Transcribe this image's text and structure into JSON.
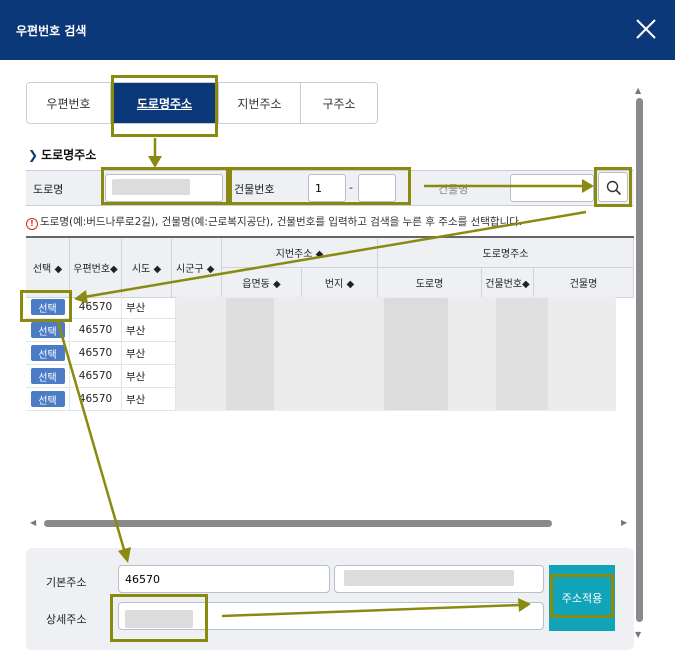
{
  "dialog": {
    "title": "우편번호 검색"
  },
  "tabs": [
    {
      "label": "우편번호",
      "active": false
    },
    {
      "label": "도로명주소",
      "active": true
    },
    {
      "label": "지번주소",
      "active": false
    },
    {
      "label": "구주소",
      "active": false
    }
  ],
  "section": {
    "title": "도로명주소"
  },
  "search": {
    "road_label": "도로명",
    "building_no_label": "건물번호",
    "building_no_main": "1",
    "building_no_dash": "-",
    "building_no_sub": "",
    "building_name_label": "건물명"
  },
  "notice": "도로명(예:버드나루로2길), 건물명(예:근로복지공단), 건물번호를 입력하고 검색을 누른 후 주소를 선택합니다.",
  "grid": {
    "headers": {
      "select": "선택 ◆",
      "zip": "우편번호◆",
      "sido": "시도 ◆",
      "sigungu": "시군구 ◆",
      "jibun_group": "지번주소 ◆",
      "umd": "읍면동 ◆",
      "bunji": "번지 ◆",
      "road_group": "도로명주소",
      "road_name": "도로명",
      "bldg_no": "건물번호◆",
      "bldg_name": "건물명"
    },
    "rows": [
      {
        "select": "선택",
        "zip": "46570",
        "sido": "부산"
      },
      {
        "select": "선택",
        "zip": "46570",
        "sido": "부산"
      },
      {
        "select": "선택",
        "zip": "46570",
        "sido": "부산"
      },
      {
        "select": "선택",
        "zip": "46570",
        "sido": "부산"
      },
      {
        "select": "선택",
        "zip": "46570",
        "sido": "부산"
      }
    ]
  },
  "bottom": {
    "base_label": "기본주소",
    "base_zip": "46570",
    "detail_label": "상세주소",
    "apply_label": "주소적용"
  },
  "colors": {
    "header": "#0b3878",
    "apply": "#11a3b7",
    "select_button": "#4c7cc6",
    "highlight": "#8a8a10"
  },
  "icons": {
    "close": "close-icon",
    "search": "search-icon",
    "section": "chevron-right-icon",
    "notice": "alert-icon"
  }
}
